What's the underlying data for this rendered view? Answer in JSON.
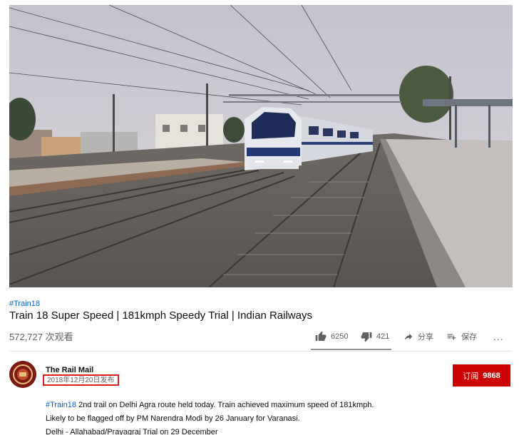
{
  "video": {
    "hashtag": "#Train18",
    "title": "Train 18 Super Speed | 181kmph Speedy Trial | Indian Railways",
    "views": "572,727 次观看"
  },
  "actions": {
    "like_count": "6250",
    "dislike_count": "421",
    "share_label": "分享",
    "save_label": "保存",
    "more_label": "..."
  },
  "channel": {
    "name": "The Rail Mail",
    "published": "2018年12月20日发布",
    "subscribe_label": "订阅",
    "subscriber_count": "9868"
  },
  "description": {
    "tag": "#Train18",
    "line1_rest": " 2nd trail on Delhi Agra route held today. Train achieved maximum speed of 181kmph.",
    "line2": "Likely to be flagged off by PM Narendra Modi by 26 January for Varanasi.",
    "line3": "Delhi - Allahabad/Prayagraj Trial on 29 December"
  },
  "colors": {
    "link": "#065fd4",
    "subscribe": "#cc0000",
    "highlight_box": "#d62020"
  },
  "icons": [
    "thumb-up-icon",
    "thumb-down-icon",
    "share-icon",
    "save-playlist-icon",
    "more-icon"
  ]
}
